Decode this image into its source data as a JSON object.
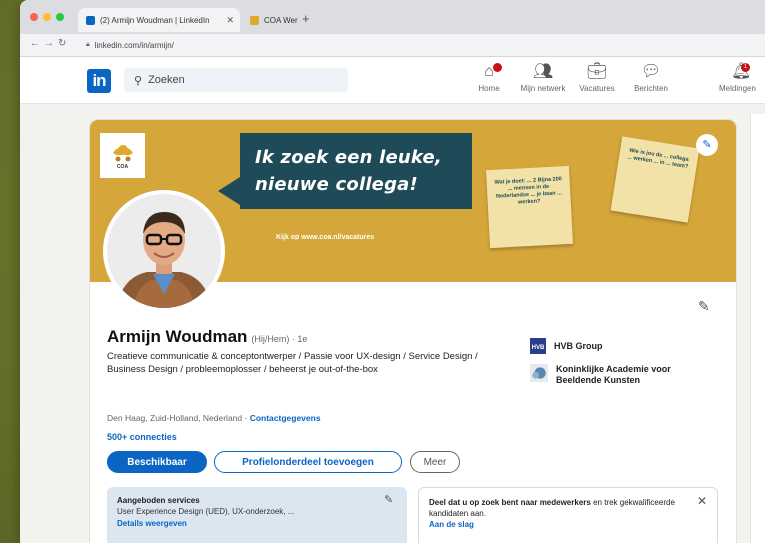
{
  "browser": {
    "tabs": [
      {
        "title": "(2) Armijn Woudman | LinkedIn",
        "active": true
      },
      {
        "title": "COA Werken bij | COA Vacatures",
        "active": false
      }
    ],
    "url": "linkedin.com/in/armijn/"
  },
  "linkedin": {
    "search_placeholder": "Zoeken",
    "nav": [
      {
        "label": "Home",
        "icon": "home-icon",
        "badge": ""
      },
      {
        "label": "Mijn netwerk",
        "icon": "network-icon",
        "badge": ""
      },
      {
        "label": "Vacatures",
        "icon": "briefcase-icon",
        "badge": ""
      },
      {
        "label": "Berichten",
        "icon": "message-icon",
        "badge": ""
      },
      {
        "label": "Meldingen",
        "icon": "bell-icon",
        "badge": "1"
      }
    ]
  },
  "profile": {
    "banner": {
      "org_logo_text": "COA",
      "line1": "Ik zoek een leuke,",
      "line2": "nieuwe collega!",
      "link": "Kijk op www.coa.nl/vacatures",
      "note1": "Wat je doet: ... 2 Bijna 200 ... mensen in de Nederlandse ... je baan ... werken?",
      "note2": "Wie is jou de ... collega ... werken ... in ... team?"
    },
    "name": "Armijn Woudman",
    "pronouns": "(Hij/Hem) · 1e",
    "headline": "Creatieve communicatie & conceptontwerper / Passie voor UX-design / Service Design / Business Design / probleemoplosser / beheerst je out-of-the-box",
    "location": "Den Haag, Zuid-Holland, Nederland ·",
    "contact_link": "Contactgegevens",
    "connections": "500+ connecties",
    "buttons": {
      "available": "Beschikbaar",
      "add_section": "Profielonderdeel toevoegen",
      "more": "Meer"
    },
    "companies": [
      {
        "name": "HVB Group",
        "logo_color": "#2b3e8c"
      },
      {
        "name": "Koninklijke Academie voor Beeldende Kunsten",
        "logo_color": "#5b86b0"
      }
    ],
    "services": {
      "title": "Aangeboden services",
      "description": "User Experience Design (UED), UX-onderzoek, ...",
      "link": "Details weergeven"
    },
    "share": {
      "text_bold": "Deel dat u op zoek bent naar medewerkers",
      "text_rest": " en trek gekwalificeerde kandidaten aan.",
      "link": "Aan de slag"
    }
  },
  "colors": {
    "linkedin_blue": "#0a66c2",
    "banner_gold": "#d5a63a",
    "banner_teal": "#1f4b59"
  }
}
